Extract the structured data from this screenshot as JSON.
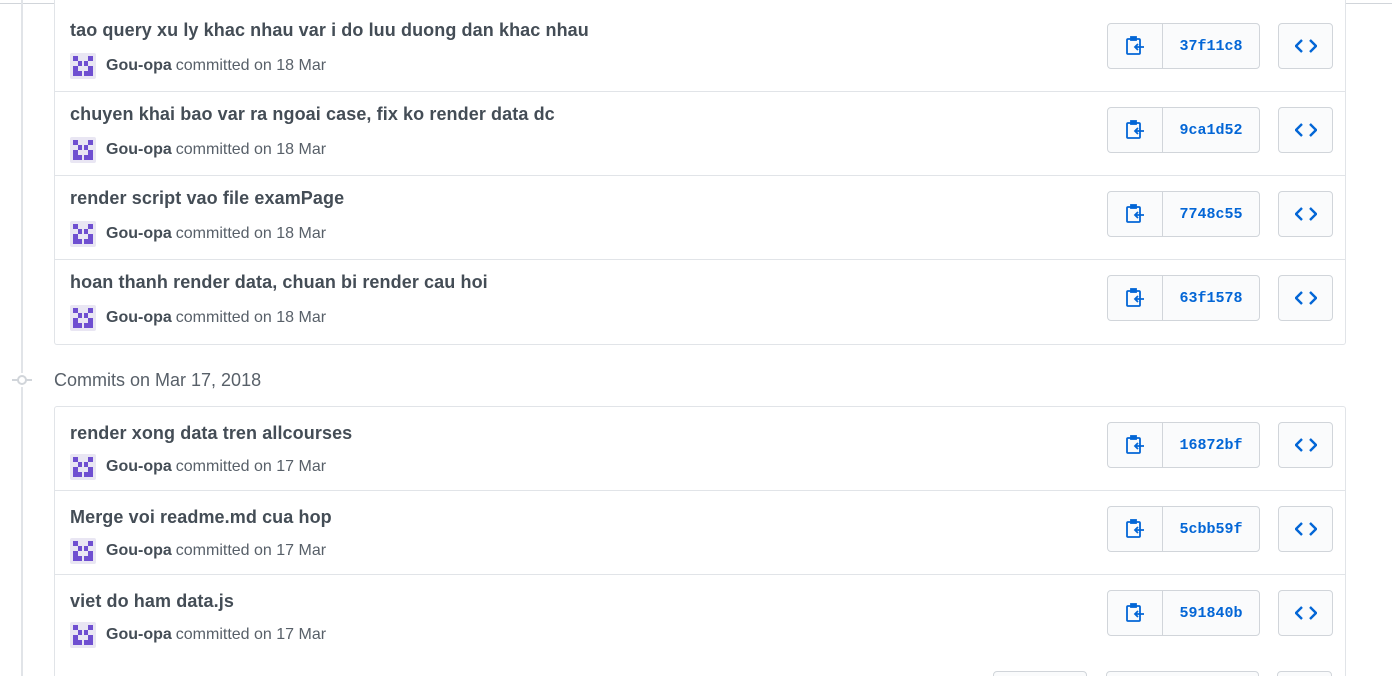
{
  "groups": [
    {
      "date_header": "",
      "commits": [
        {
          "message": "tao query xu ly khac nhau var i do luu duong dan khac nhau",
          "author": "Gou-opa",
          "action": "committed on 18 Mar",
          "sha": "37f11c8"
        },
        {
          "message": "chuyen khai bao var ra ngoai case, fix ko render data dc",
          "author": "Gou-opa",
          "action": "committed on 18 Mar",
          "sha": "9ca1d52"
        },
        {
          "message": "render script vao file examPage",
          "author": "Gou-opa",
          "action": "committed on 18 Mar",
          "sha": "7748c55"
        },
        {
          "message": "hoan thanh render data, chuan bi render cau hoi",
          "author": "Gou-opa",
          "action": "committed on 18 Mar",
          "sha": "63f1578"
        }
      ]
    },
    {
      "date_header": "Commits on Mar 17, 2018",
      "commits": [
        {
          "message": "render xong data tren allcourses",
          "author": "Gou-opa",
          "action": "committed on 17 Mar",
          "sha": "16872bf"
        },
        {
          "message": "Merge voi readme.md cua hop",
          "author": "Gou-opa",
          "action": "committed on 17 Mar",
          "sha": "5cbb59f"
        },
        {
          "message": "viet do ham data.js",
          "author": "Gou-opa",
          "action": "committed on 17 Mar",
          "sha": "591840b"
        }
      ]
    }
  ],
  "icons": {
    "copy": "clippy-icon",
    "browse": "code-icon",
    "commit_node": "git-commit-icon",
    "avatar": "identicon"
  },
  "colors": {
    "link": "#0366d6",
    "avatar": "#6f4fd1",
    "border": "#e1e4e8"
  }
}
